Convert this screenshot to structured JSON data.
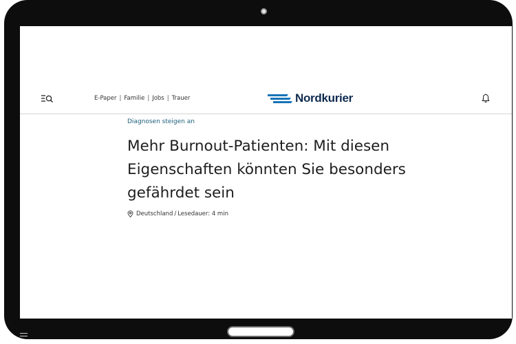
{
  "header": {
    "links": [
      "E-Paper",
      "Familie",
      "Jobs",
      "Trauer"
    ],
    "separator": "|",
    "logo_text": "Nordkurier",
    "icons": {
      "menu": "menu-search-icon",
      "notifications": "bell-icon"
    },
    "brand_color": "#0f2a4f",
    "logo_mark_color": "#1673b8"
  },
  "article": {
    "kicker": "Diagnosen steigen an",
    "headline": "Mehr Burnout-Patienten: Mit diesen Eigenschaften könnten Sie besonders gefährdet sein",
    "location": "Deutschland",
    "meta_separator": "/",
    "reading_time": "Lesedauer: 4 min",
    "kicker_color": "#1b5d7a"
  }
}
